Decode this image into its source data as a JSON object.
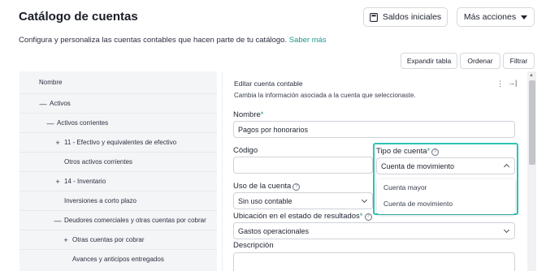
{
  "page": {
    "title": "Catálogo de cuentas",
    "subtitle": "Configura y personaliza las cuentas contables que hacen parte de tu catálogo.",
    "subtitle_link": "Saber más"
  },
  "header_buttons": {
    "saldos": "Saldos iniciales",
    "mas_acciones": "Más acciones"
  },
  "toolbar": {
    "expandir": "Expandir tabla",
    "ordenar": "Ordenar",
    "filtrar": "Filtrar"
  },
  "tree": {
    "header": "Nombre",
    "rows": [
      {
        "symbol": "—",
        "label": "Activos"
      },
      {
        "symbol": "—",
        "label": "Activos corrientes"
      },
      {
        "symbol": "+",
        "label": "11 - Efectivo y equivalentes de efectivo"
      },
      {
        "symbol": "",
        "label": "Otros activos corrientes"
      },
      {
        "symbol": "+",
        "label": "14 - Inventario"
      },
      {
        "symbol": "",
        "label": "Inversiones a corto plazo"
      },
      {
        "symbol": "—",
        "label": "Deudores comerciales y otras cuentas por cobrar"
      },
      {
        "symbol": "+",
        "label": "Otras cuentas por cobrar"
      },
      {
        "symbol": "",
        "label": "Avances y anticipos entregados"
      }
    ]
  },
  "edit_panel": {
    "title": "Editar cuenta contable",
    "description": "Cambia la información asociada a la cuenta que seleccionaste.",
    "kebab_icon": "⋮",
    "collapse_icon": "→|",
    "nombre_label": "Nombre",
    "nombre_value": "Pagos por honorarios",
    "codigo_label": "Código",
    "codigo_value": "",
    "tipo_label": "Tipo de cuenta",
    "tipo_value": "Cuenta de movimiento",
    "tipo_options": [
      "Cuenta mayor",
      "Cuenta de movimiento"
    ],
    "uso_label": "Uso de la cuenta",
    "uso_value": "Sin uso contable",
    "ubicacion_label": "Ubicación en el estado de resultados",
    "ubicacion_value": "Gastos operacionales",
    "descripcion_label": "Descripción",
    "required_mark": "*",
    "help_mark": "?"
  },
  "colors": {
    "accent": "#2ec4b6",
    "link": "#1a9a8a",
    "tree_bg": "#f4f5f7"
  }
}
